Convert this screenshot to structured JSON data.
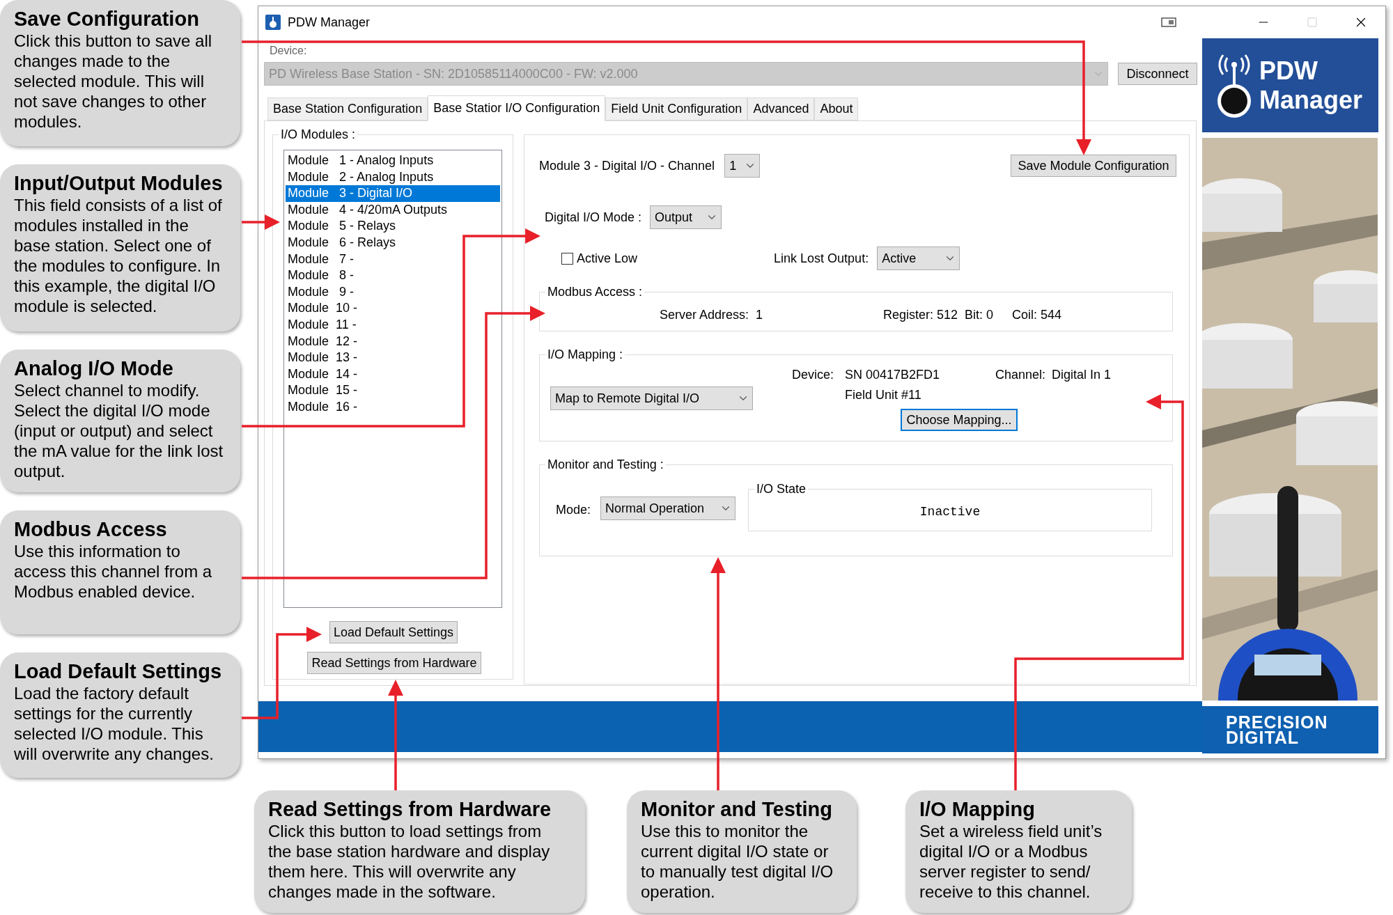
{
  "callouts": [
    {
      "title": "Save Configuration",
      "body": "Click this button to save all changes made to the selected module. This will not save changes to other modules."
    },
    {
      "title": "Input/Output Modules",
      "body": "This field consists of a list of modules installed in the base station. Select one of the modules to configure. In this example, the digital I/O module is selected."
    },
    {
      "title": "Analog I/O Mode",
      "body": "Select channel to modify. Select the digital I/O mode (input or output) and select the mA value for the link lost output."
    },
    {
      "title": "Modbus Access",
      "body": "Use this information to access this channel from a Modbus enabled device."
    },
    {
      "title": "Load Default Settings",
      "body": "Load the factory default settings for the currently selected I/O module. This will overwrite any changes."
    }
  ],
  "bottom_callouts": [
    {
      "title": "Read Settings from Hardware",
      "body": "Click this button to load settings from the base station hardware and display them here. This will overwrite any changes made in the software."
    },
    {
      "title": "Monitor and Testing",
      "body": "Use this to monitor the current digital I/O state or to manually test digital I/O operation."
    },
    {
      "title": "I/O Mapping",
      "body": "Set a wireless field unit’s digital I/O or a Modbus server register to send/ receive to this channel."
    }
  ],
  "window": {
    "title": "PDW Manager"
  },
  "device": {
    "label": "Device:",
    "value": "PD Wireless Base Station - SN: 2D10585114000C00 - FW: v2.000",
    "disabled": true
  },
  "disconnect_button": "Disconnect",
  "tabs": [
    {
      "label": "Base Station Configuration",
      "selected": false
    },
    {
      "label": "Base Statior I/O Configuration",
      "selected": true
    },
    {
      "label": "Field Unit Configuration",
      "selected": false
    },
    {
      "label": "Advanced",
      "selected": false
    },
    {
      "label": "About",
      "selected": false
    }
  ],
  "io_modules": {
    "title": "I/O Modules :",
    "items": [
      {
        "label": "Module   1 - Analog Inputs",
        "selected": false
      },
      {
        "label": "Module   2 - Analog Inputs",
        "selected": false
      },
      {
        "label": "Module   3 - Digital I/O",
        "selected": true
      },
      {
        "label": "Module   4 - 4/20mA Outputs",
        "selected": false
      },
      {
        "label": "Module   5 - Relays",
        "selected": false
      },
      {
        "label": "Module   6 - Relays",
        "selected": false
      },
      {
        "label": "Module   7 -",
        "selected": false
      },
      {
        "label": "Module   8 -",
        "selected": false
      },
      {
        "label": "Module   9 -",
        "selected": false
      },
      {
        "label": "Module  10 -",
        "selected": false
      },
      {
        "label": "Module  11 -",
        "selected": false
      },
      {
        "label": "Module  12 -",
        "selected": false
      },
      {
        "label": "Module  13 -",
        "selected": false
      },
      {
        "label": "Module  14 -",
        "selected": false
      },
      {
        "label": "Module  15 -",
        "selected": false
      },
      {
        "label": "Module  16 -",
        "selected": false
      }
    ]
  },
  "buttons": {
    "load_default": "Load Default Settings",
    "read_settings": "Read Settings from Hardware"
  },
  "module_header": {
    "title": "Module 3 - Digital I/O - Channel",
    "channel": "1"
  },
  "save_button": "Save Module Configuration",
  "mode": {
    "label": "Digital I/O Mode :",
    "value": "Output"
  },
  "active_low": {
    "label": "Active Low",
    "checked": false
  },
  "link_lost": {
    "label": "Link Lost Output:",
    "value": "Active"
  },
  "modbus": {
    "title": "Modbus Access :",
    "server_address": "Server Address:  1",
    "register": "Register: 512  Bit: 0",
    "coil": "Coil: 544"
  },
  "mapping": {
    "title": "I/O Mapping :",
    "mode": "Map to Remote Digital I/O",
    "device_label": "Device:",
    "device_sn": "SN 00417B2FD1",
    "field_unit": "Field Unit #11",
    "channel_label": "Channel:",
    "channel_value": "Digital In 1",
    "choose_button": "Choose Mapping..."
  },
  "monitor": {
    "title": "Monitor and Testing :",
    "mode_label": "Mode:",
    "mode_value": "Normal Operation",
    "state_title": "I/O State",
    "state_value": "Inactive"
  },
  "banner": {
    "app_name": [
      "PDW",
      "Manager"
    ],
    "photo": {
      "kind": "picture"
    },
    "company": [
      "PRECISION",
      "DIGITAL"
    ]
  }
}
